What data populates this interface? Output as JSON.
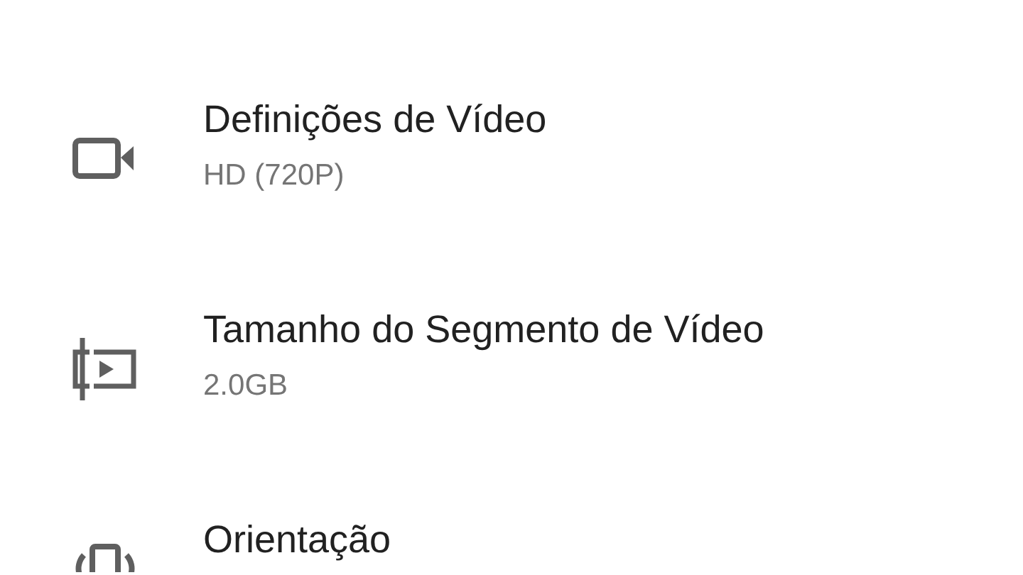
{
  "settings": [
    {
      "title": "Definições de Vídeo",
      "subtitle": "HD (720P)"
    },
    {
      "title": "Tamanho do Segmento de Vídeo",
      "subtitle": "2.0GB"
    },
    {
      "title": "Orientação"
    }
  ]
}
